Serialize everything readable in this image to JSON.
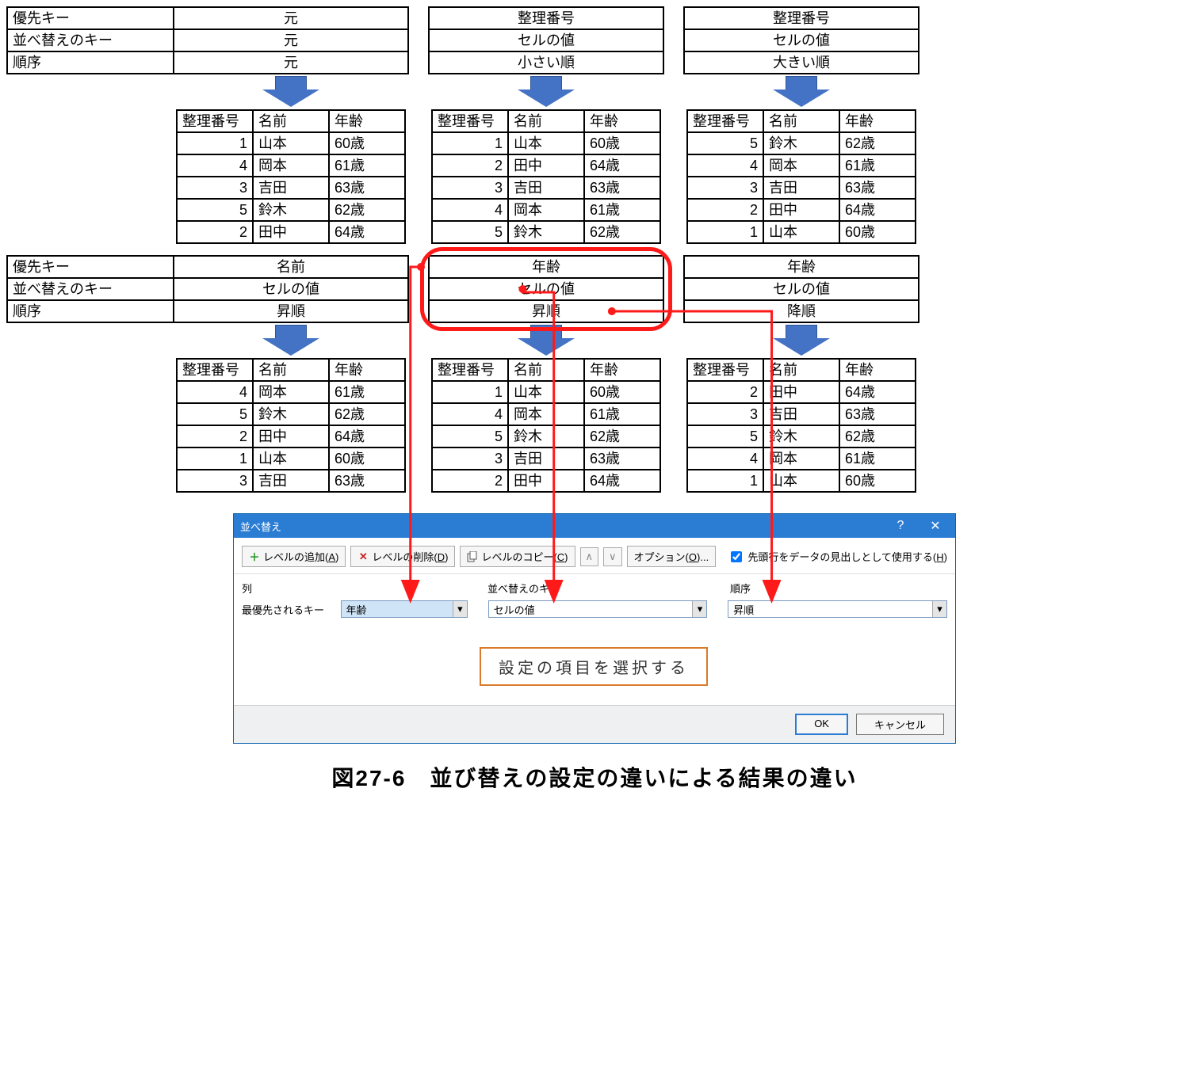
{
  "keyLabels": {
    "priority": "優先キー",
    "sortKey": "並べ替えのキー",
    "order": "順序"
  },
  "dataHeaders": [
    "整理番号",
    "名前",
    "年齢"
  ],
  "top": [
    {
      "cfg": [
        "元",
        "元",
        "元"
      ],
      "rows": [
        [
          "1",
          "山本",
          "60歳"
        ],
        [
          "4",
          "岡本",
          "61歳"
        ],
        [
          "3",
          "吉田",
          "63歳"
        ],
        [
          "5",
          "鈴木",
          "62歳"
        ],
        [
          "2",
          "田中",
          "64歳"
        ]
      ]
    },
    {
      "cfg": [
        "整理番号",
        "セルの値",
        "小さい順"
      ],
      "rows": [
        [
          "1",
          "山本",
          "60歳"
        ],
        [
          "2",
          "田中",
          "64歳"
        ],
        [
          "3",
          "吉田",
          "63歳"
        ],
        [
          "4",
          "岡本",
          "61歳"
        ],
        [
          "5",
          "鈴木",
          "62歳"
        ]
      ]
    },
    {
      "cfg": [
        "整理番号",
        "セルの値",
        "大きい順"
      ],
      "rows": [
        [
          "5",
          "鈴木",
          "62歳"
        ],
        [
          "4",
          "岡本",
          "61歳"
        ],
        [
          "3",
          "吉田",
          "63歳"
        ],
        [
          "2",
          "田中",
          "64歳"
        ],
        [
          "1",
          "山本",
          "60歳"
        ]
      ]
    }
  ],
  "bottom": [
    {
      "cfg": [
        "名前",
        "セルの値",
        "昇順"
      ],
      "rows": [
        [
          "4",
          "岡本",
          "61歳"
        ],
        [
          "5",
          "鈴木",
          "62歳"
        ],
        [
          "2",
          "田中",
          "64歳"
        ],
        [
          "1",
          "山本",
          "60歳"
        ],
        [
          "3",
          "吉田",
          "63歳"
        ]
      ]
    },
    {
      "cfg": [
        "年齢",
        "セルの値",
        "昇順"
      ],
      "rows": [
        [
          "1",
          "山本",
          "60歳"
        ],
        [
          "4",
          "岡本",
          "61歳"
        ],
        [
          "5",
          "鈴木",
          "62歳"
        ],
        [
          "3",
          "吉田",
          "63歳"
        ],
        [
          "2",
          "田中",
          "64歳"
        ]
      ]
    },
    {
      "cfg": [
        "年齢",
        "セルの値",
        "降順"
      ],
      "rows": [
        [
          "2",
          "田中",
          "64歳"
        ],
        [
          "3",
          "吉田",
          "63歳"
        ],
        [
          "5",
          "鈴木",
          "62歳"
        ],
        [
          "4",
          "岡本",
          "61歳"
        ],
        [
          "1",
          "山本",
          "60歳"
        ]
      ]
    }
  ],
  "dialog": {
    "title": "並べ替え",
    "addLevel": "レベルの追加(",
    "addLevelKey": "A",
    "delLevel": "レベルの削除(",
    "delLevelKey": "D",
    "copyLevel": "レベルのコピー(",
    "copyLevelKey": "C",
    "options": "オプション(",
    "optionsKey": "O",
    "optionsEllipsis": ")...",
    "headerCheckbox": "先頭行をデータの見出しとして使用する(",
    "headerCheckboxKey": "H",
    "colsHeader": [
      "列",
      "並べ替えのキー",
      "順序"
    ],
    "rowLabel": "最優先されるキー",
    "col": "年齢",
    "key": "セルの値",
    "order": "昇順",
    "ok": "OK",
    "cancel": "キャンセル",
    "callout": "設定の項目を選択する",
    "closeParen": ")"
  },
  "caption": "図27-6　並び替えの設定の違いによる結果の違い"
}
